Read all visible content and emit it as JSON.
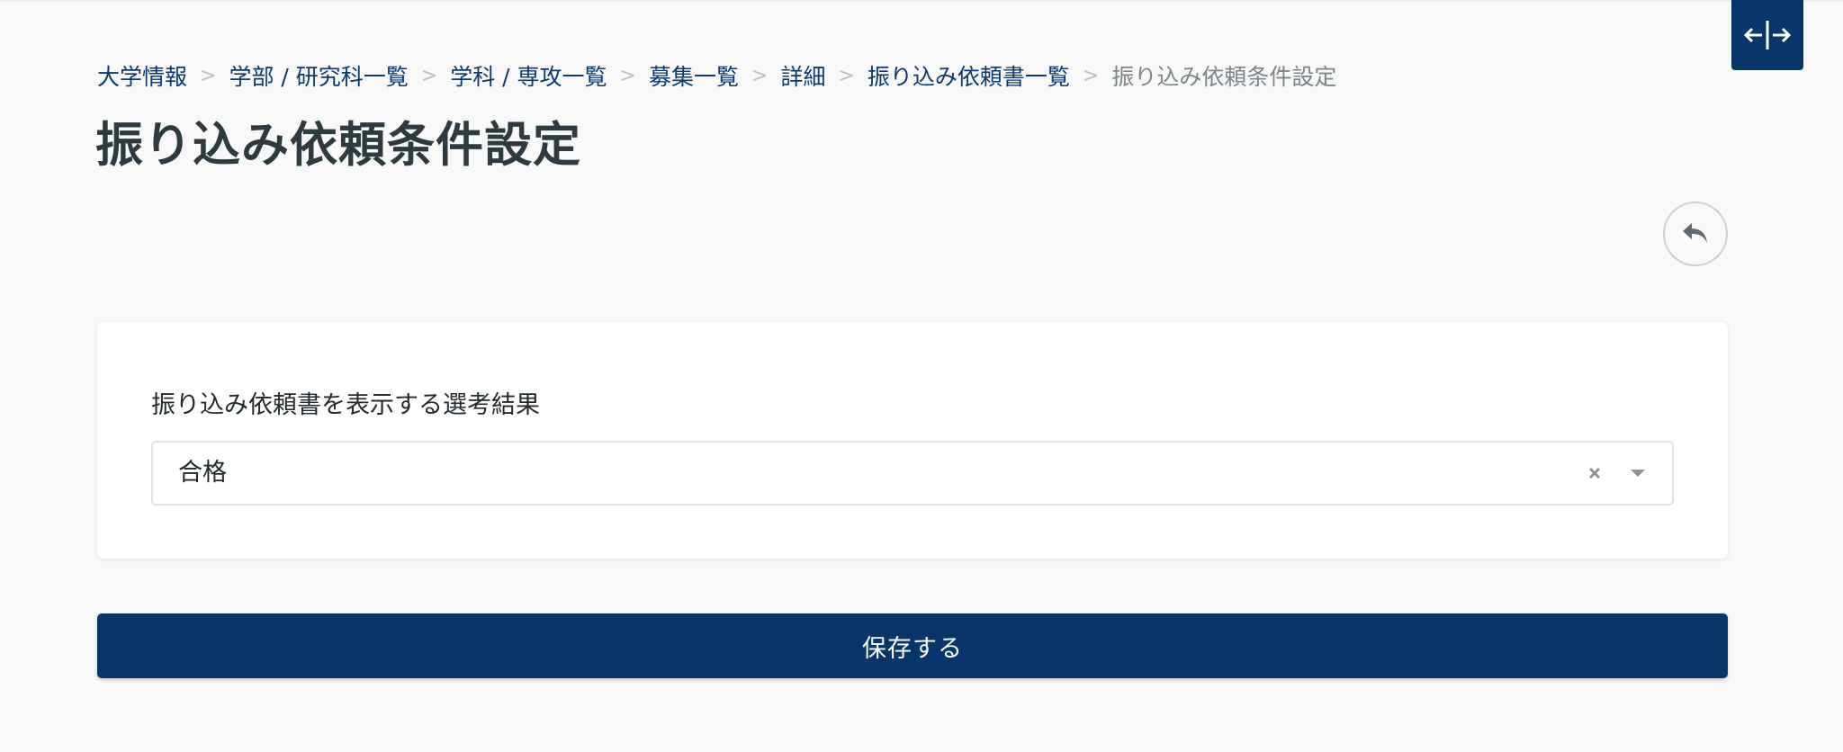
{
  "breadcrumb": {
    "items": [
      {
        "label": "大学情報"
      },
      {
        "label": "学部 / 研究科一覧"
      },
      {
        "label": "学科 / 専攻一覧"
      },
      {
        "label": "募集一覧"
      },
      {
        "label": "詳細"
      },
      {
        "label": "振り込み依頼書一覧"
      }
    ],
    "current": "振り込み依頼条件設定",
    "separator": ">"
  },
  "page_title": "振り込み依頼条件設定",
  "form": {
    "field_label": "振り込み依頼書を表示する選考結果",
    "select_value": "合格"
  },
  "save_label": "保存する",
  "icons": {
    "sidebar_toggle": "expand-horizontal-icon",
    "back": "reply-arrow-icon",
    "clear": "close-icon",
    "dropdown": "chevron-down-icon"
  },
  "colors": {
    "primary": "#08356a",
    "background": "#f8f8f8",
    "link": "#0d3a6e",
    "title": "#2d3a40"
  }
}
